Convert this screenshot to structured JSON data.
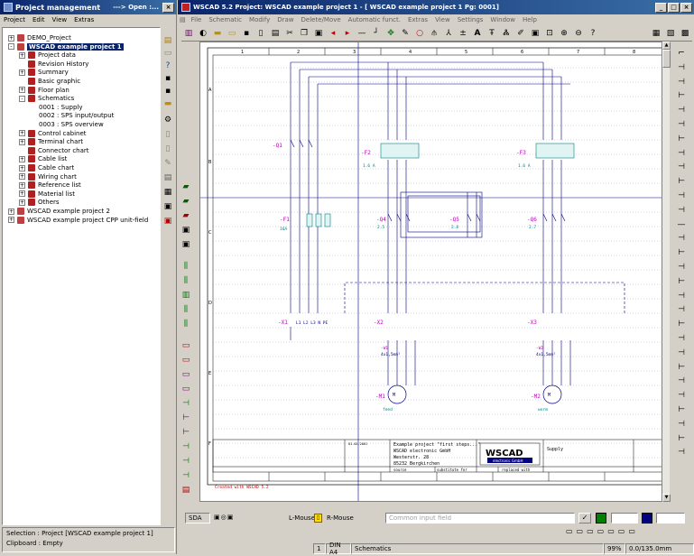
{
  "left_window": {
    "title": "Project management",
    "title_right": "---> Open :...",
    "menu": [
      "Project",
      "Edit",
      "View",
      "Extras"
    ],
    "tree": [
      {
        "label": "DEMO_Project",
        "expander": "+"
      },
      {
        "label": "WSCAD example project 1",
        "expander": "-"
      },
      {
        "label": "Project data",
        "expander": "+"
      },
      {
        "label": "Revision History",
        "expander": ""
      },
      {
        "label": "Summary",
        "expander": "+"
      },
      {
        "label": "Basic graphic",
        "expander": ""
      },
      {
        "label": "Floor plan",
        "expander": "+"
      },
      {
        "label": "Schematics",
        "expander": "-"
      },
      {
        "label": "0001 : Supply",
        "expander": ""
      },
      {
        "label": "0002 : SPS input/output",
        "expander": ""
      },
      {
        "label": "0003 : SPS overview",
        "expander": ""
      },
      {
        "label": "Control cabinet",
        "expander": "+"
      },
      {
        "label": "Terminal chart",
        "expander": "+"
      },
      {
        "label": "Connector chart",
        "expander": ""
      },
      {
        "label": "Cable list",
        "expander": "+"
      },
      {
        "label": "Cable chart",
        "expander": "+"
      },
      {
        "label": "Wiring chart",
        "expander": "+"
      },
      {
        "label": "Reference list",
        "expander": "+"
      },
      {
        "label": "Material list",
        "expander": "+"
      },
      {
        "label": "Others",
        "expander": "+"
      },
      {
        "label": "WSCAD example project 2",
        "expander": "+"
      },
      {
        "label": "WSCAD example project CPP unit-field",
        "expander": "+"
      }
    ],
    "selection": "Selection : Project [WSCAD example project 1]",
    "clipboard": "Clipboard : Empty"
  },
  "main_window": {
    "title": "WSCAD 5.2   Project: WSCAD example project 1 - [ WSCAD example project 1  Pg: 0001]",
    "menu": [
      "File",
      "Schematic",
      "Modify",
      "Draw",
      "Delete/Move",
      "Automatic funct.",
      "Extras",
      "View",
      "Settings",
      "Window",
      "Help"
    ],
    "status": {
      "sda": "SDA",
      "l_mouse": "L-Mouse",
      "r_mouse": "R-Mouse",
      "input_placeholder": "Common input field",
      "page": "1",
      "format": "DIN A4",
      "view": "Schematics",
      "zoom": "99%",
      "coords": "0.0/135.0mm"
    }
  },
  "drawing": {
    "columns": [
      "1",
      "2",
      "3",
      "4",
      "5",
      "6",
      "7",
      "8"
    ],
    "rows": [
      "A",
      "B",
      "C",
      "D",
      "E",
      "F"
    ],
    "components": {
      "q1": "-Q1",
      "f2": "-F2",
      "f2_rating": "1.6 A",
      "f3": "-F3",
      "f3_rating": "1.6 A",
      "f1": "-F1",
      "f1_rating": "16A",
      "q4": "-Q4",
      "q4_ref": "2.5",
      "q5": "-Q5",
      "q5_ref": "2.8",
      "q6": "-Q6",
      "q6_ref": "2.7",
      "x1": "-X1",
      "x1_terms": "L1  L2  L3  N  PE",
      "x2": "-X2",
      "x3": "-X3",
      "m1": "-M1",
      "m1_name": "feed",
      "m2": "-M2",
      "m2_name": "worm",
      "w1": "-W1",
      "w2": "-W2",
      "cable_spec": "4x1,5mm²"
    },
    "title_block": {
      "project_text": "Example project \"first steps...\"",
      "company": "WSCAD electronic GmbH",
      "street": "Westerstr. 28",
      "city": "85232 Bergkirchen",
      "logo_top": "WSCAD",
      "logo_bottom": "electronic GmbH",
      "page_title": "Supply",
      "date": "01.02.2001",
      "source": "source",
      "substitute": "substitute for",
      "replaced": "replaced with",
      "footer": "Created with WSCAD 5.2"
    }
  }
}
